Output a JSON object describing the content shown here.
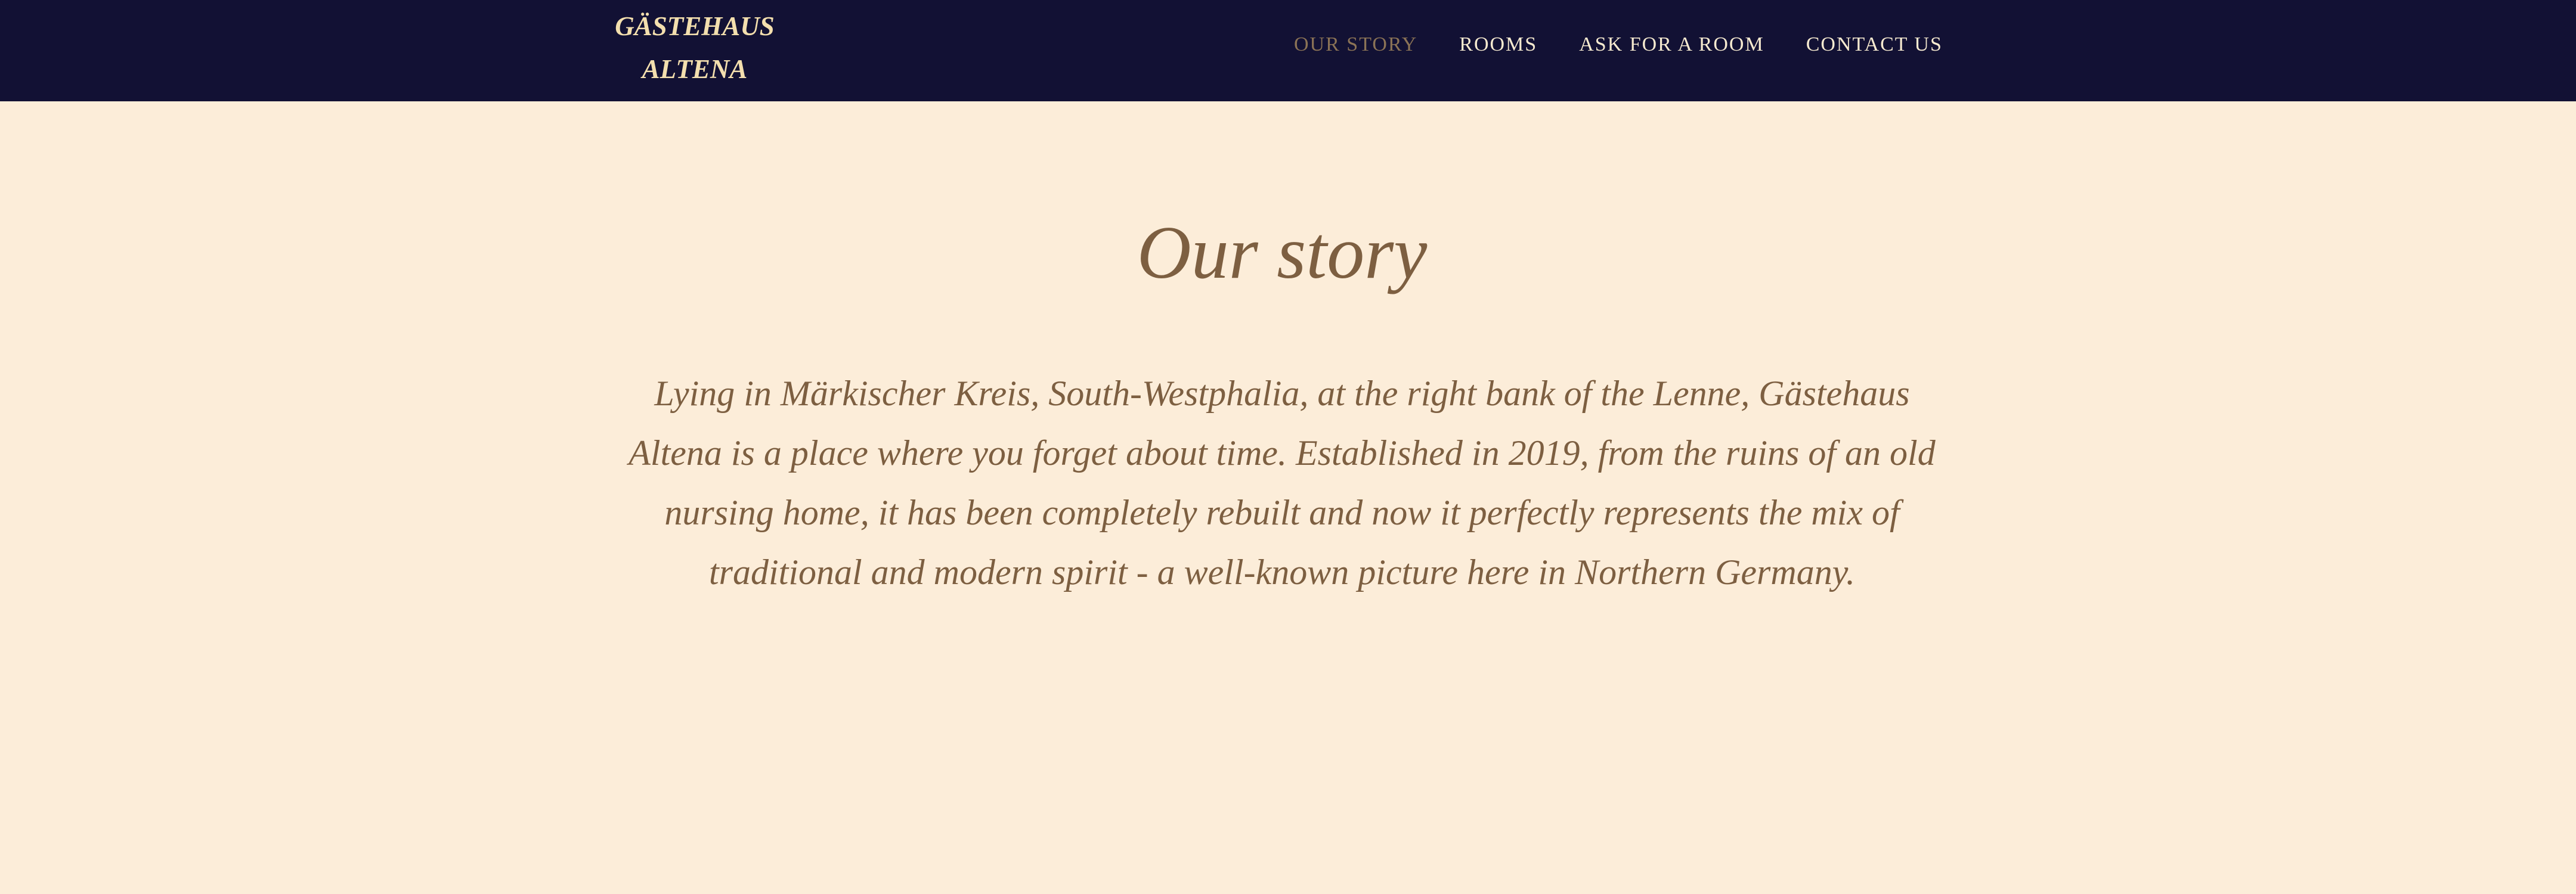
{
  "brand": {
    "line1": "GÄSTEHAUS",
    "line2": "ALTENA"
  },
  "nav": {
    "items": [
      {
        "label": "OUR STORY",
        "active": true
      },
      {
        "label": "ROOMS",
        "active": false
      },
      {
        "label": "ASK FOR A ROOM",
        "active": false
      },
      {
        "label": "CONTACT US",
        "active": false
      }
    ]
  },
  "main": {
    "title": "Our story",
    "paragraph": "Lying in Märkischer Kreis, South-Westphalia, at the right bank of the Lenne, Gästehaus Altena is a place where you forget about time. Established in 2019, from the ruins of an old nursing home, it has been completely rebuilt and now it perfectly represents the mix of traditional and modern spirit - a well-known picture here in Northern Germany."
  },
  "colors": {
    "navbar_bg": "#121134",
    "page_bg": "#fcedd9",
    "text_brown": "#7d5f41",
    "logo_gold": "#f3dfae",
    "nav_active": "#8b7356"
  }
}
